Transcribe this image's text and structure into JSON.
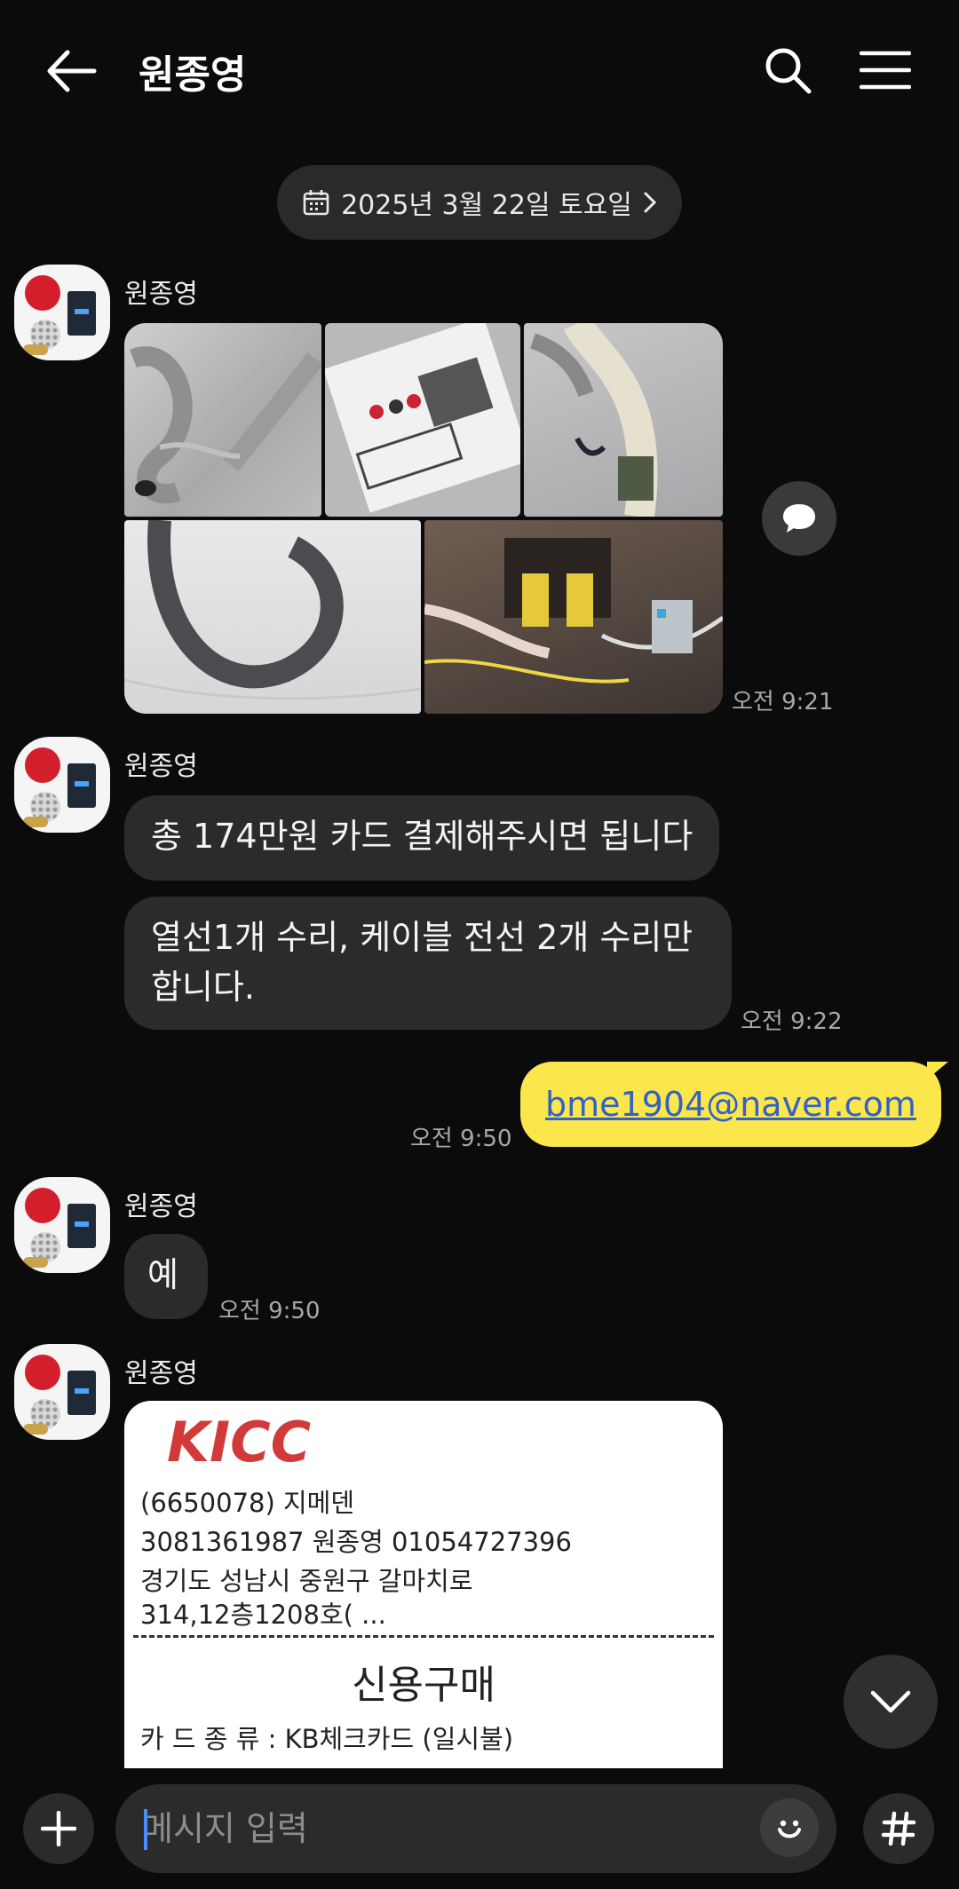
{
  "header": {
    "title": "원종영",
    "back_icon": "arrow-left-icon",
    "search_icon": "search-icon",
    "menu_icon": "menu-icon"
  },
  "date_divider": {
    "label": "2025년 3월 22일 토요일",
    "icon": "calendar-icon"
  },
  "messages": {
    "group1": {
      "sender": "원종영",
      "time": "오전 9:21"
    },
    "group2": {
      "sender": "원종영",
      "bubble1": "총 174만원 카드 결제해주시면 됩니다",
      "bubble2": "열선1개 수리, 케이블 전선 2개 수리만 합니다.",
      "time": "오전 9:22"
    },
    "mine1": {
      "text": "bme1904@naver.com",
      "time": "오전 9:50"
    },
    "group3": {
      "sender": "원종영",
      "bubble1": "예",
      "time": "오전 9:50"
    },
    "group4": {
      "sender": "원종영"
    }
  },
  "receipt": {
    "logo_text": "KICC",
    "line1": "(6650078) 지메덴",
    "line2": "3081361987  원종영     01054727396",
    "line3": "경기도 성남시 중원구 갈마치로",
    "line4": "314,12층1208호( ...",
    "heading": "신용구매",
    "line5": "카 드 종 류  :  KB체크카드      (일시불)"
  },
  "composer": {
    "placeholder": "메시지 입력",
    "plus_icon": "plus-icon",
    "emoji_icon": "emoji-icon",
    "hash_icon": "hash-icon"
  },
  "colors": {
    "background": "#0b0b0b",
    "bubble_other": "#2b2b2b",
    "bubble_mine": "#fbe64c",
    "link": "#3261c8"
  }
}
